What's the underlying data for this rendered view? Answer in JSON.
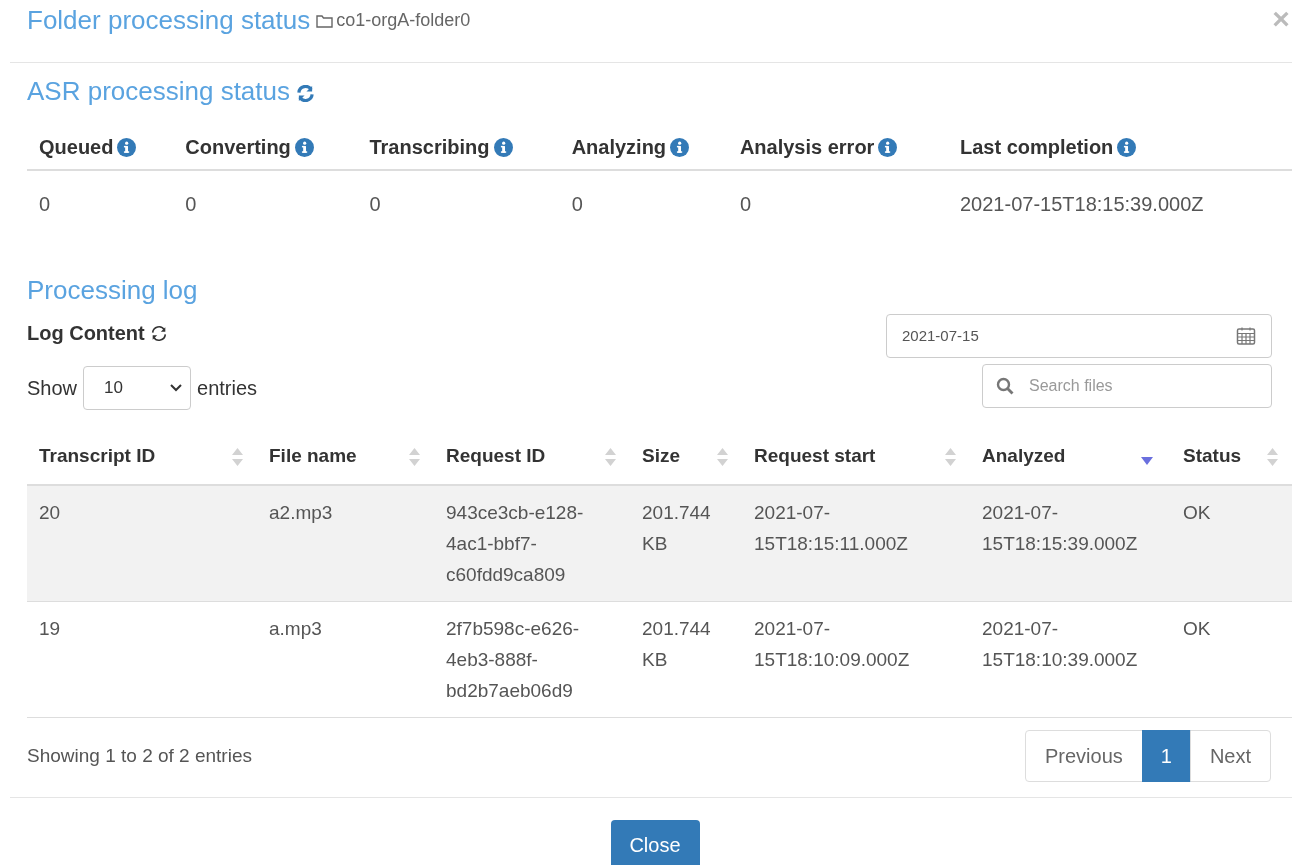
{
  "dialog": {
    "title": "Folder processing status",
    "folder": "co1-orgA-folder0",
    "close_glyph": "×"
  },
  "asr_status": {
    "heading": "ASR processing status",
    "columns": [
      "Queued",
      "Converting",
      "Transcribing",
      "Analyzing",
      "Analysis error",
      "Last completion"
    ],
    "values": [
      "0",
      "0",
      "0",
      "0",
      "0",
      "2021-07-15T18:15:39.000Z"
    ]
  },
  "processing_log": {
    "heading": "Processing log",
    "subheading": "Log Content",
    "date": "2021-07-15",
    "length": {
      "before": "Show",
      "value": "10",
      "after": "entries"
    },
    "search": {
      "placeholder": "Search files"
    },
    "columns": [
      {
        "label": "Transcript ID",
        "sorted": false
      },
      {
        "label": "File name",
        "sorted": false
      },
      {
        "label": "Request ID",
        "sorted": false
      },
      {
        "label": "Size",
        "sorted": false
      },
      {
        "label": "Request start",
        "sorted": false
      },
      {
        "label": "Analyzed",
        "sorted": true
      },
      {
        "label": "Status",
        "sorted": false
      }
    ],
    "rows": [
      {
        "highlighted": true,
        "cells": [
          "20",
          "a2.mp3",
          "943ce3cb-e128-4ac1-bbf7-c60fdd9ca809",
          "201.744 KB",
          "2021-07-15T18:15:11.000Z",
          "2021-07-15T18:15:39.000Z",
          "OK"
        ]
      },
      {
        "highlighted": false,
        "cells": [
          "19",
          "a.mp3",
          "2f7b598c-e626-4eb3-888f-bd2b7aeb06d9",
          "201.744 KB",
          "2021-07-15T18:10:09.000Z",
          "2021-07-15T18:10:39.000Z",
          "OK"
        ]
      }
    ],
    "info": "Showing 1 to 2 of 2 entries",
    "pagination": [
      {
        "label": "Previous",
        "selected": false
      },
      {
        "label": "1",
        "selected": true
      },
      {
        "label": "Next",
        "selected": false
      }
    ]
  },
  "footer": {
    "button": "Close"
  }
}
